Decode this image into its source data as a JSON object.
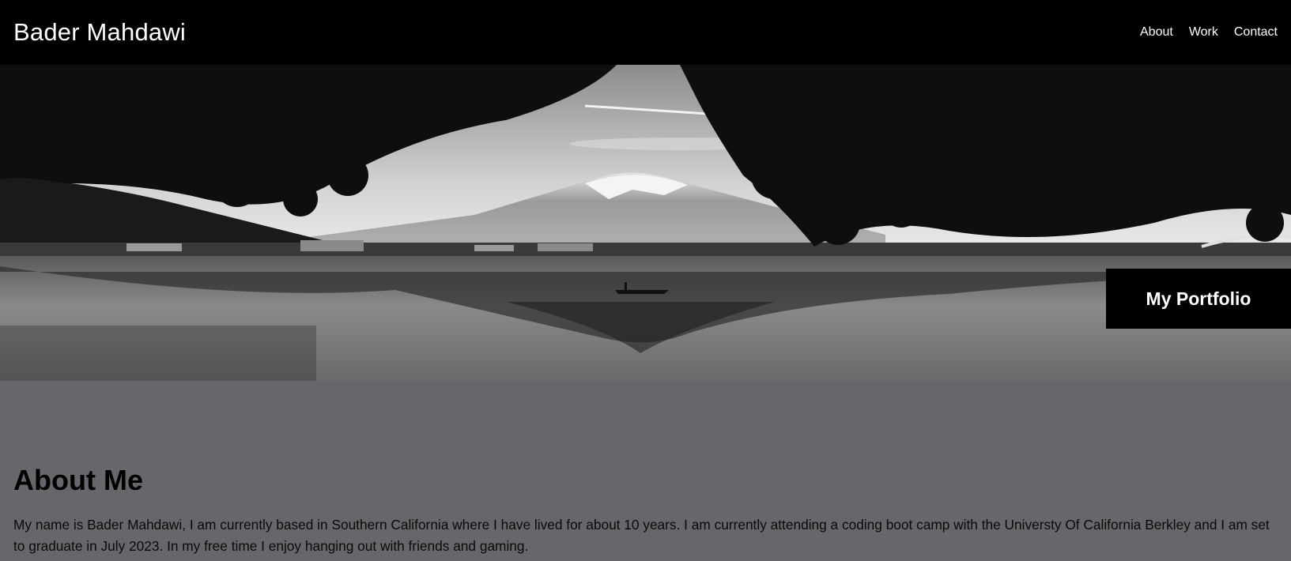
{
  "header": {
    "title": "Bader Mahdawi",
    "nav": [
      {
        "label": "About"
      },
      {
        "label": "Work"
      },
      {
        "label": "Contact"
      }
    ]
  },
  "hero": {
    "badge_label": "My Portfolio",
    "image_icon": "mountain-lake-landscape"
  },
  "about": {
    "heading": "About Me",
    "body": "My name is Bader Mahdawi, I am currently based in Southern California where I have lived for about 10 years. I am currently attending a coding boot camp with the Universty Of California Berkley and I am set to graduate in July 2023. In my free time I enjoy hanging out with friends and gaming."
  },
  "colors": {
    "header_bg": "#000000",
    "page_bg": "#66676a",
    "badge_bg": "#000000",
    "text_light": "#ffffff"
  }
}
